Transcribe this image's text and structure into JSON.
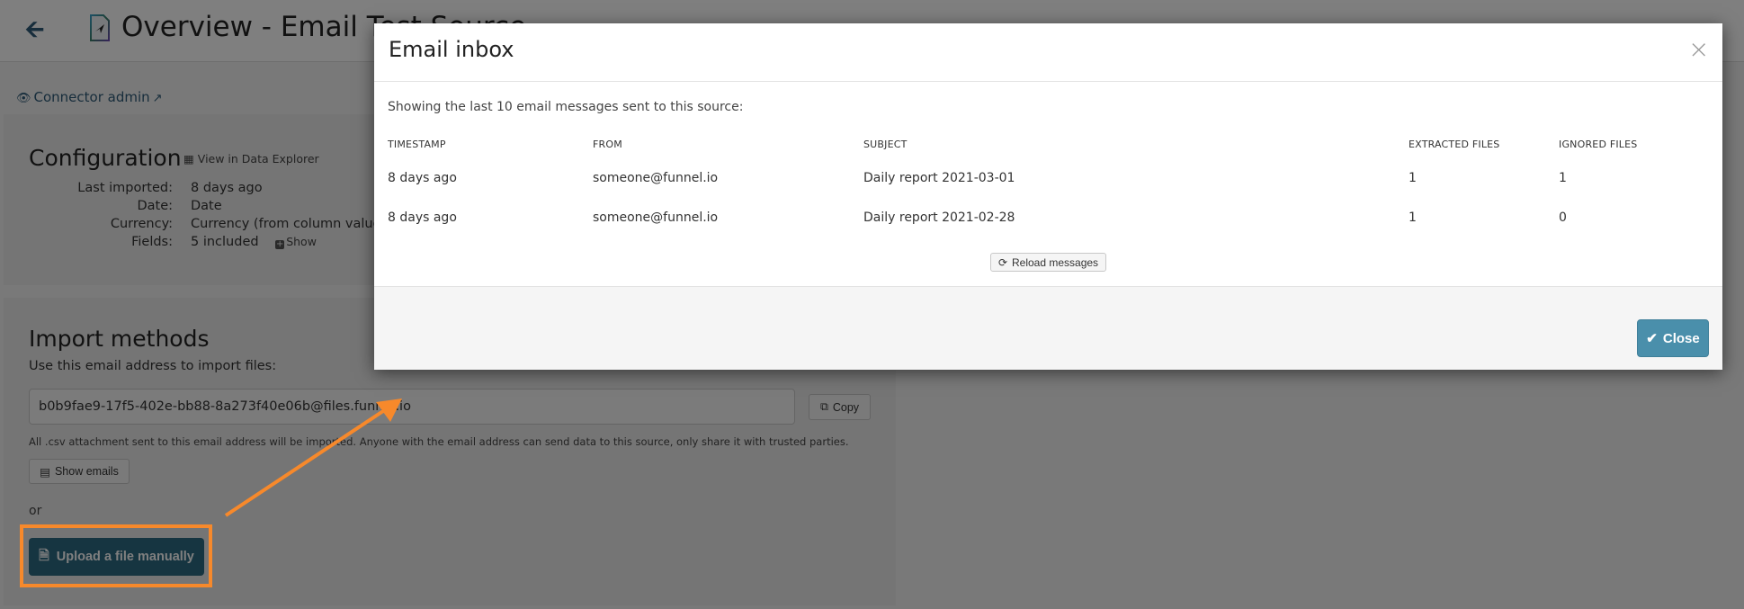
{
  "header": {
    "back_icon": "arrow-left-icon",
    "doc_icon": "send-document-icon",
    "title": "Overview - Email Test Source"
  },
  "connector_admin": {
    "icon": "eye-icon",
    "label": "Connector admin",
    "ext_icon": "external-link-icon"
  },
  "configuration": {
    "title": "Configuration",
    "view_in_data_explorer": "View in Data Explorer",
    "rows": [
      {
        "key": "Last imported:",
        "value": "8 days ago"
      },
      {
        "key": "Date:",
        "value": "Date"
      },
      {
        "key": "Currency:",
        "value": "Currency (from column values)"
      },
      {
        "key": "Fields:",
        "value": "5 included"
      }
    ],
    "show_label": "Show"
  },
  "import_methods": {
    "title": "Import methods",
    "email_label": "Use this email address to import files:",
    "email_value": "b0b9fae9-17f5-402e-bb88-8a273f40e06b@files.funnel.io",
    "copy_label": "Copy",
    "hint": "All .csv attachment sent to this email address will be imported. Anyone with the email address can send data to this source, only share it with trusted parties.",
    "show_emails_label": "Show emails",
    "or_label": "or",
    "upload_label": "Upload a file manually"
  },
  "modal": {
    "title": "Email inbox",
    "intro": "Showing the last 10 email messages sent to this source:",
    "columns": [
      "TIMESTAMP",
      "FROM",
      "SUBJECT",
      "EXTRACTED FILES",
      "IGNORED FILES"
    ],
    "rows": [
      [
        "8 days ago",
        "someone@funnel.io",
        "Daily report 2021-03-01",
        "1",
        "1"
      ],
      [
        "8 days ago",
        "someone@funnel.io",
        "Daily report 2021-02-28",
        "1",
        "0"
      ]
    ],
    "reload_label": "Reload messages",
    "close_label": "Close"
  },
  "annotation": {
    "color": "#f7892b"
  }
}
